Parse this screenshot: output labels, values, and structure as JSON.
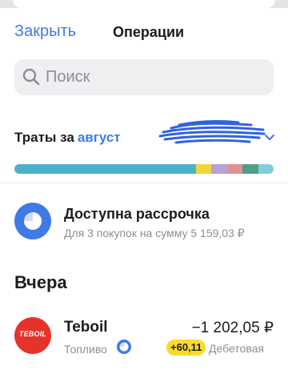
{
  "header": {
    "close_label": "Закрыть",
    "title": "Операции"
  },
  "search": {
    "placeholder": "Поиск"
  },
  "spending": {
    "label": "Траты за",
    "month": "август",
    "breakdown_colors": [
      "#4eb1cb",
      "#f1d638",
      "#b7a1d9",
      "#e48f8f",
      "#4f9e8a",
      "#7fcde0"
    ]
  },
  "installment": {
    "title": "Доступна рассрочка",
    "subtitle": "Для 3 покупок на сумму 5 159,03 ₽"
  },
  "section": {
    "title": "Вчера"
  },
  "transaction": {
    "merchant": "Teboil",
    "logo_text": "TEBOIL",
    "category": "Топливо",
    "amount": "−1 202,05 ₽",
    "bonus": "+60,11",
    "account": "Дебетовая"
  },
  "colors": {
    "accent": "#3f7ae6",
    "logo_red": "#e5332a",
    "bonus_yellow": "#f7dc2e"
  }
}
